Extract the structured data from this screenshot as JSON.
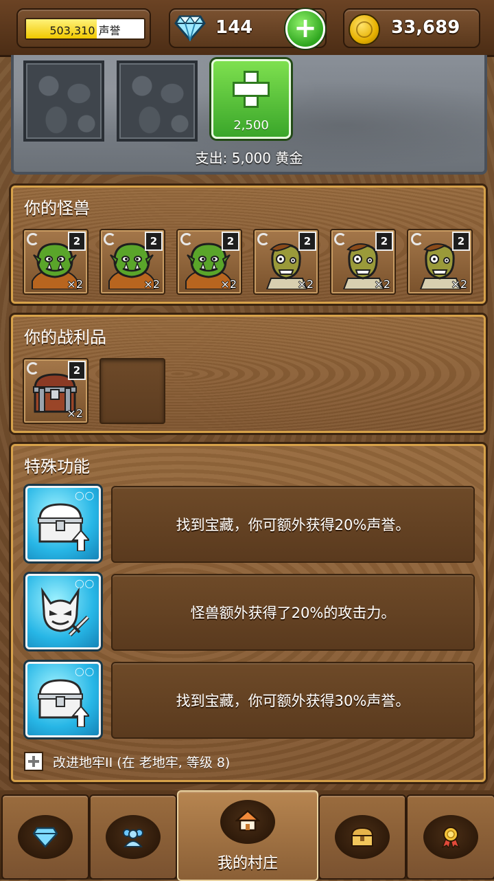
{
  "top_bar": {
    "reputation": {
      "value_text": "503,310 声誉",
      "fill_fraction": 0.6
    },
    "gems": {
      "count": "144",
      "icon": "diamond-icon"
    },
    "gold": {
      "count": "33,689",
      "icon": "gold-coin-icon"
    }
  },
  "dungeon": {
    "add_room_cost": "2,500",
    "expense_text": "支出: 5,000 黄金"
  },
  "monsters": {
    "title": "你的怪兽",
    "items": [
      {
        "kind": "orc",
        "level": "2",
        "count": "×2"
      },
      {
        "kind": "orc",
        "level": "2",
        "count": "×2"
      },
      {
        "kind": "orc",
        "level": "2",
        "count": "×2"
      },
      {
        "kind": "zombie",
        "level": "2",
        "count": "×2"
      },
      {
        "kind": "zombie",
        "level": "2",
        "count": "×2"
      },
      {
        "kind": "zombie",
        "level": "2",
        "count": "×2"
      }
    ]
  },
  "loot": {
    "title": "你的战利品",
    "items": [
      {
        "kind": "treasure-chest",
        "level": "2",
        "count": "×2"
      }
    ]
  },
  "special": {
    "title": "特殊功能",
    "features": [
      {
        "icon": "treasure-chest-up-icon",
        "text": "找到宝藏，你可额外获得20%声誉。"
      },
      {
        "icon": "demon-sword-icon",
        "text": "怪兽额外获得了20%的攻击力。"
      },
      {
        "icon": "treasure-chest-up-icon",
        "text": "找到宝藏，你可额外获得30%声誉。"
      }
    ],
    "improve_text": "改进地牢II (在 老地牢, 等级 8)"
  },
  "bottom_nav": {
    "tabs": [
      {
        "icon": "diamond-icon",
        "label": ""
      },
      {
        "icon": "people-icon",
        "label": ""
      },
      {
        "icon": "house-icon",
        "label": "我的村庄"
      },
      {
        "icon": "treasure-chest-icon",
        "label": ""
      },
      {
        "icon": "medal-icon",
        "label": ""
      }
    ]
  },
  "colors": {
    "wood": "#8a6036",
    "panel_border": "#d7a24a",
    "feature_icon_blue": "#27b6e6",
    "add_button_green": "#3aa62a",
    "reputation_fill": "#f0c800"
  }
}
